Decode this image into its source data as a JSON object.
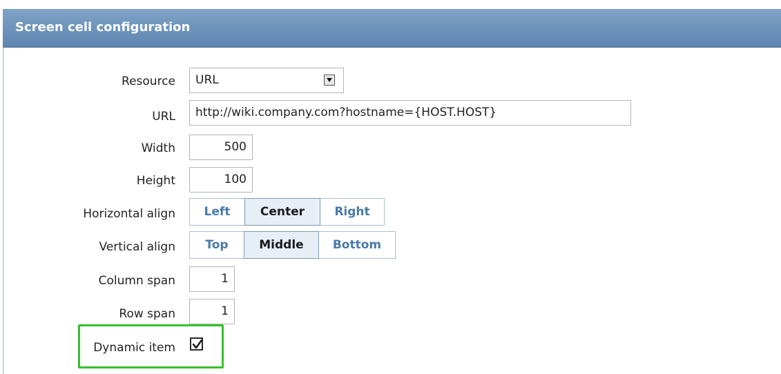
{
  "header": {
    "title": "Screen cell configuration"
  },
  "form": {
    "resource": {
      "label": "Resource",
      "value": "URL"
    },
    "url": {
      "label": "URL",
      "value": "http://wiki.company.com?hostname={HOST.HOST}"
    },
    "width": {
      "label": "Width",
      "value": "500"
    },
    "height": {
      "label": "Height",
      "value": "100"
    },
    "halign": {
      "label": "Horizontal align",
      "options": [
        "Left",
        "Center",
        "Right"
      ],
      "selected": "Center"
    },
    "valign": {
      "label": "Vertical align",
      "options": [
        "Top",
        "Middle",
        "Bottom"
      ],
      "selected": "Middle"
    },
    "colspan": {
      "label": "Column span",
      "value": "1"
    },
    "rowspan": {
      "label": "Row span",
      "value": "1"
    },
    "dynamic": {
      "label": "Dynamic item",
      "checked": true
    }
  },
  "colors": {
    "highlight": "#35c12b",
    "header": "#6b93bc",
    "link": "#4a79a8"
  }
}
